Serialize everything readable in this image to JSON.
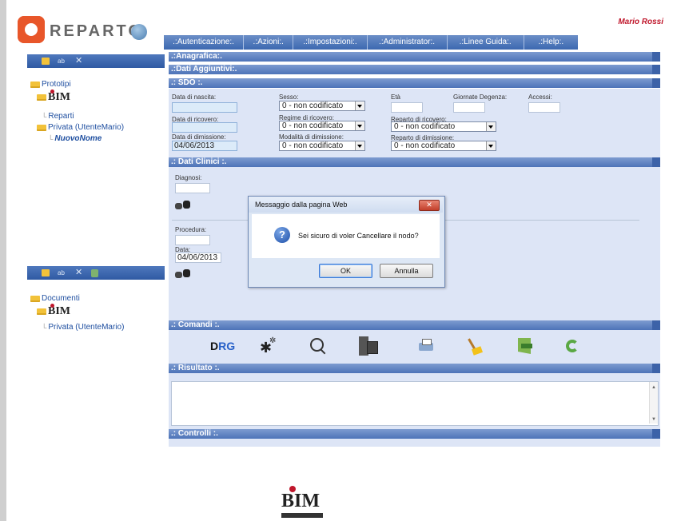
{
  "app": {
    "logo_text": "REPARTO",
    "user": "Mario Rossi"
  },
  "menu": [
    ".:Autenticazione:.",
    ".:Azioni:.",
    ".:Impostazioni:.",
    ".:Administrator:.",
    ".:Linee Guida:.",
    ".:Help:."
  ],
  "tree1": {
    "root": "Prototipi",
    "bim_label": "BIM",
    "reparti": "Reparti",
    "privata": "Privata (UtenteMario)",
    "selected": "NuovoNome"
  },
  "tree2": {
    "root": "Documenti",
    "bim_label": "BIM",
    "privata": "Privata (UtenteMario)"
  },
  "sections": {
    "anagrafica": ".:Anagrafica:.",
    "dati_aggiuntivi": ".:Dati Aggiuntivi:.",
    "sdo": ".: SDO :.",
    "dati_clinici": ".: Dati Clinici :.",
    "comandi": ".: Comandi :.",
    "risultato": ".: Risultato :.",
    "controlli": ".: Controlli :."
  },
  "sdo": {
    "data_nascita_label": "Data di nascita:",
    "data_nascita": "",
    "sesso_label": "Sesso:",
    "sesso": "0 - non codificato",
    "eta_label": "Età",
    "eta": "",
    "giornate_label": "Giornate Degenza:",
    "giornate": "",
    "accessi_label": "Accessi:",
    "accessi": "",
    "data_ricovero_label": "Data di ricovero:",
    "data_ricovero": "",
    "regime_label": "Regime di ricovero:",
    "regime": "0 - non codificato",
    "reparto_ricovero_label": "Reparto di ricovero:",
    "reparto_ricovero": "0 - non codificato",
    "data_dimissione_label": "Data di dimissione:",
    "data_dimissione": "04/06/2013",
    "modalita_label": "Modalità di dimissione:",
    "modalita": "0 - non codificato",
    "reparto_dimissione_label": "Reparto di dimissione:",
    "reparto_dimissione": "0 - non codificato"
  },
  "clinici": {
    "diagnosi_label": "Diagnosi:",
    "diagnosi": "",
    "procedura_label": "Procedura:",
    "procedura": "",
    "data_label": "Data:",
    "data": "04/06/2013"
  },
  "commands": {
    "drg_text": "D",
    "drg_sub": "RG"
  },
  "dialog": {
    "title": "Messaggio dalla pagina Web",
    "close": "✕",
    "message": "Sei sicuro di voler Cancellare il nodo?",
    "ok": "OK",
    "cancel": "Annulla"
  },
  "footer": {
    "logo": "BIM"
  },
  "colors": {
    "accent": "#3c68b0",
    "user": "#c0172c",
    "panel_bg": "#dde5f6"
  },
  "icons": [
    "folder-icon",
    "rename-icon",
    "delete-icon",
    "tree-icon",
    "binoculars-icon",
    "gear-icon",
    "search-icon",
    "database-icon",
    "print-icon",
    "broom-icon",
    "exit-icon",
    "refresh-icon",
    "question-icon",
    "close-icon"
  ]
}
